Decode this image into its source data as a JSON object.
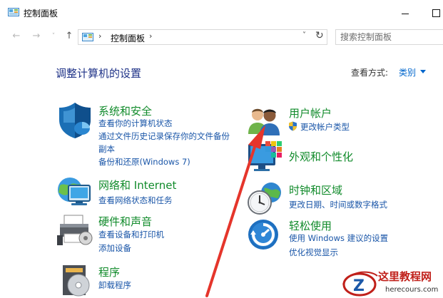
{
  "window": {
    "title": "控制面板"
  },
  "addressbar": {
    "back_glyph": "←",
    "forward_glyph": "→",
    "recent_glyph": "˅",
    "up_glyph": "↑",
    "separator": "›",
    "crumb": "控制面板",
    "dropdown_glyph": "˅",
    "refresh_glyph": "↻"
  },
  "search": {
    "placeholder": "搜索控制面板"
  },
  "content": {
    "heading": "调整计算机的设置",
    "view_by_label": "查看方式:",
    "view_by_value": "类别"
  },
  "categories": [
    {
      "title": "系统和安全",
      "icon": "shield-icon",
      "links": [
        "查看你的计算机状态",
        "通过文件历史记录保存你的文件备份",
        "副本",
        "备份和还原(Windows 7)"
      ]
    },
    {
      "title": "网络和 Internet",
      "icon": "network-globe-icon",
      "links": [
        "查看网络状态和任务"
      ]
    },
    {
      "title": "硬件和声音",
      "icon": "printer-icon",
      "links": [
        "查看设备和打印机",
        "添加设备"
      ]
    },
    {
      "title": "程序",
      "icon": "programs-disc-icon",
      "links": [
        "卸载程序"
      ]
    },
    {
      "title": "用户帐户",
      "icon": "users-icon",
      "links": [
        "更改帐户类型"
      ]
    },
    {
      "title": "外观和个性化",
      "icon": "monitor-palette-icon",
      "links": []
    },
    {
      "title": "时钟和区域",
      "icon": "clock-globe-icon",
      "links": [
        "更改日期、时间或数字格式"
      ]
    },
    {
      "title": "轻松使用",
      "icon": "ease-of-access-icon",
      "links": [
        "使用 Windows 建议的设置",
        "优化视觉显示"
      ]
    }
  ],
  "watermark": {
    "title": "这里教程网",
    "url": "herecours.com"
  }
}
